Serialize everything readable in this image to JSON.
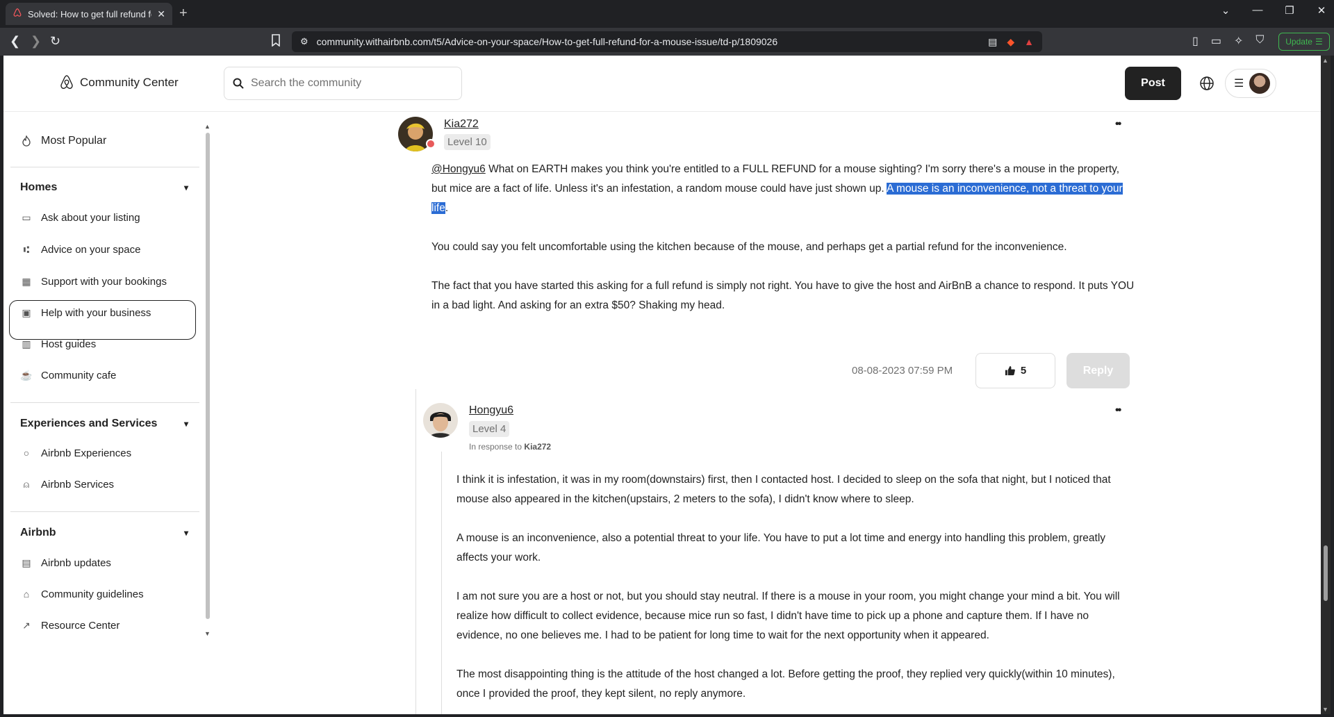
{
  "browser": {
    "tab_title": "Solved: How to get full refund fo",
    "url": "community.withairbnb.com/t5/Advice-on-your-space/How-to-get-full-refund-for-a-mouse-issue/td-p/1809026",
    "update_label": "Update"
  },
  "header": {
    "brand": "Community Center",
    "search_placeholder": "Search the community",
    "post_label": "Post"
  },
  "sidebar": {
    "most_popular": "Most Popular",
    "sections": [
      {
        "title": "Homes",
        "items": [
          "Ask about your listing",
          "Advice on your space",
          "Support with your bookings",
          "Help with your business",
          "Host guides",
          "Community cafe"
        ]
      },
      {
        "title": "Experiences and Services",
        "items": [
          "Airbnb Experiences",
          "Airbnb Services"
        ]
      },
      {
        "title": "Airbnb",
        "items": [
          "Airbnb updates",
          "Community guidelines",
          "Resource Center"
        ]
      }
    ]
  },
  "posts": [
    {
      "username": "Kia272",
      "level": "Level 10",
      "mention": "@Hongyu6",
      "p1_a": " What on EARTH makes you think you're entitled to a FULL REFUND for a mouse sighting? I'm sorry there's a mouse in the property, but mice are a fact of life. Unless it's an infestation, a random mouse could have just shown up. ",
      "p1_highlight": "A mouse is an inconvenience, not a threat to your life",
      "p1_end": ".",
      "p2": "You could say you felt uncomfortable using the kitchen because of the mouse, and perhaps get a partial refund for the inconvenience.",
      "p3": "The fact that you have started this asking for a full refund is simply not right. You have to give the host and AirBnB a chance to respond. It puts YOU in a bad light. And asking for an extra $50? Shaking my head.",
      "timestamp": "08-08-2023 07:59 PM",
      "likes": "5",
      "reply_label": "Reply"
    },
    {
      "username": "Hongyu6",
      "level": "Level 4",
      "in_response_prefix": "In response to",
      "in_response_to": "Kia272",
      "p1": "I think it is infestation, it was in my room(downstairs) first, then I contacted host. I decided to sleep on the sofa that night, but I noticed that mouse also appeared in the kitchen(upstairs, 2 meters to the sofa), I didn't know where to sleep.",
      "p2": "A mouse is an inconvenience, also a potential threat to your life. You have to put a lot time and energy into handling this problem, greatly affects your work.",
      "p3": "I am not sure you are a host or not, but you should stay neutral. If there is a mouse in your room, you might change your mind a bit. You will realize how difficult to collect evidence, because mice run so fast, I didn't have time to pick up a phone and capture them. If I have no evidence, no one believes me. I had to be patient for long time to wait for the next opportunity when it appeared.",
      "p4": "The most disappointing thing is the attitude of the host changed a lot. Before getting the proof, they replied very quickly(within 10 minutes), once I provided the proof, they kept silent, no reply anymore."
    }
  ]
}
